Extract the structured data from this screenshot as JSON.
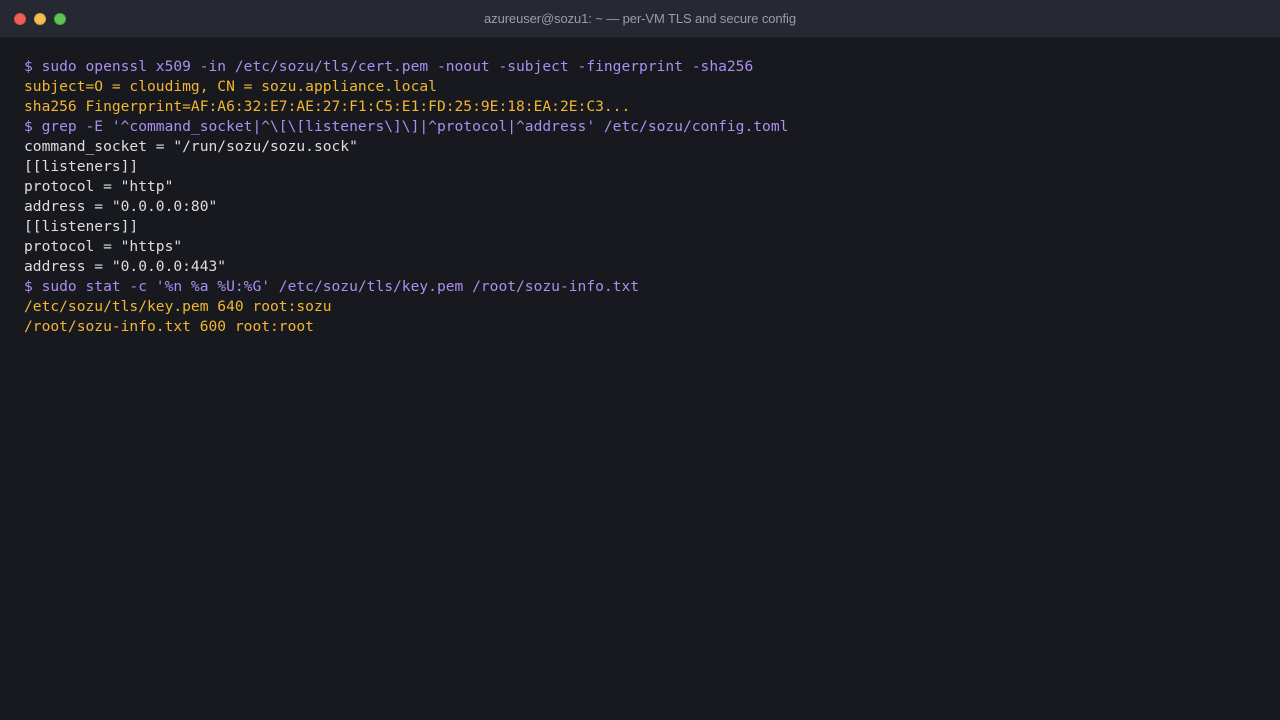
{
  "window": {
    "title": "azureuser@sozu1: ~ — per-VM TLS and secure config"
  },
  "terminal": {
    "lines": [
      {
        "kind": "command",
        "text": "$ sudo openssl x509 -in /etc/sozu/tls/cert.pem -noout -subject -fingerprint -sha256"
      },
      {
        "kind": "output-highlight",
        "text": "subject=O = cloudimg, CN = sozu.appliance.local"
      },
      {
        "kind": "output-highlight",
        "text": "sha256 Fingerprint=AF:A6:32:E7:AE:27:F1:C5:E1:FD:25:9E:18:EA:2E:C3..."
      },
      {
        "kind": "command",
        "text": "$ grep -E '^command_socket|^\\[\\[listeners\\]\\]|^protocol|^address' /etc/sozu/config.toml"
      },
      {
        "kind": "output",
        "text": "command_socket = \"/run/sozu/sozu.sock\""
      },
      {
        "kind": "output",
        "text": "[[listeners]]"
      },
      {
        "kind": "output",
        "text": "protocol = \"http\""
      },
      {
        "kind": "output",
        "text": "address = \"0.0.0.0:80\""
      },
      {
        "kind": "output",
        "text": "[[listeners]]"
      },
      {
        "kind": "output",
        "text": "protocol = \"https\""
      },
      {
        "kind": "output",
        "text": "address = \"0.0.0.0:443\""
      },
      {
        "kind": "command",
        "text": "$ sudo stat -c '%n %a %U:%G' /etc/sozu/tls/key.pem /root/sozu-info.txt"
      },
      {
        "kind": "output-highlight",
        "text": "/etc/sozu/tls/key.pem 640 root:sozu"
      },
      {
        "kind": "output-highlight",
        "text": "/root/sozu-info.txt 600 root:root"
      }
    ]
  },
  "colors": {
    "background": "#18191e",
    "titlebar": "#262931",
    "command": "#a98ff0",
    "highlight_output": "#f2b632",
    "plain_output": "#dedede"
  }
}
